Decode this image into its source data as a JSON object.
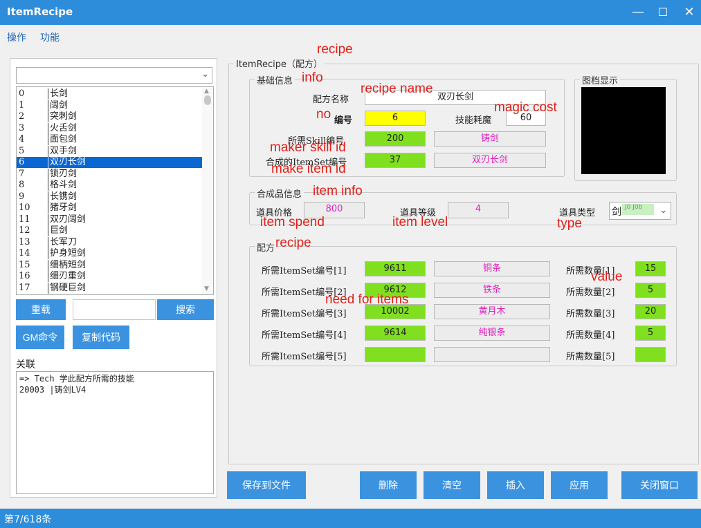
{
  "window": {
    "title": "ItemRecipe"
  },
  "menu": [
    "操作",
    "功能"
  ],
  "list": {
    "items": [
      {
        "id": "0",
        "name": "长剑"
      },
      {
        "id": "1",
        "name": "阔剑"
      },
      {
        "id": "2",
        "name": "突刺剑"
      },
      {
        "id": "3",
        "name": "火舌剑"
      },
      {
        "id": "4",
        "name": "面包剑"
      },
      {
        "id": "5",
        "name": "双手剑"
      },
      {
        "id": "6",
        "name": "双刃长剑"
      },
      {
        "id": "7",
        "name": "锁刃剑"
      },
      {
        "id": "8",
        "name": "格斗剑"
      },
      {
        "id": "9",
        "name": "长镌剑"
      },
      {
        "id": "10",
        "name": "猪牙剑"
      },
      {
        "id": "11",
        "name": "双刃阔剑"
      },
      {
        "id": "12",
        "name": "巨剑"
      },
      {
        "id": "13",
        "name": "长军刀"
      },
      {
        "id": "14",
        "name": "护身短剑"
      },
      {
        "id": "15",
        "name": "细柄短剑"
      },
      {
        "id": "16",
        "name": "细刃重剑"
      },
      {
        "id": "17",
        "name": "钢硬巨剑"
      }
    ],
    "selected_index": 6
  },
  "left_buttons": {
    "reload": "重载",
    "search": "搜索",
    "gm": "GM命令",
    "copy": "复制代码",
    "search_value": ""
  },
  "relation": {
    "label": "关联",
    "lines": [
      "=> Tech 学此配方所需的技能",
      "20003  |铸剑LV4"
    ]
  },
  "recipe_group": {
    "title": "ItemRecipe（配方）"
  },
  "basic": {
    "title": "基础信息",
    "name_label": "配方名称",
    "name_value": "双刃长剑",
    "no_label": "编号",
    "no_value": "6",
    "mp_label": "技能耗魔",
    "mp_value": "60",
    "skill_label": "所需Skill编号",
    "skill_value": "200",
    "skill_name": "铸剑",
    "itemset_label": "合成的ItemSet编号",
    "itemset_value": "37",
    "itemset_name": "双刃长剑"
  },
  "preview": {
    "title": "图档显示"
  },
  "product": {
    "title": "合成品信息",
    "price_label": "道具价格",
    "price_value": "800",
    "level_label": "道具等级",
    "level_value": "4",
    "type_label": "道具类型",
    "type_value": "剑",
    "type_ghost": "J0  J0b"
  },
  "recipe": {
    "title": "配方",
    "rows": [
      {
        "label": "所需ItemSet编号[1]",
        "id": "9611",
        "name": "铜条",
        "qty_label": "所需数量[1]",
        "qty": "15"
      },
      {
        "label": "所需ItemSet编号[2]",
        "id": "9612",
        "name": "铁条",
        "qty_label": "所需数量[2]",
        "qty": "5"
      },
      {
        "label": "所需ItemSet编号[3]",
        "id": "10002",
        "name": "黄月木",
        "qty_label": "所需数量[3]",
        "qty": "20"
      },
      {
        "label": "所需ItemSet编号[4]",
        "id": "9614",
        "name": "纯银条",
        "qty_label": "所需数量[4]",
        "qty": "5"
      },
      {
        "label": "所需ItemSet编号[5]",
        "id": "",
        "name": "",
        "qty_label": "所需数量[5]",
        "qty": ""
      }
    ]
  },
  "bottom_buttons": {
    "save": "保存到文件",
    "delete": "删除",
    "clear": "清空",
    "insert": "插入",
    "apply": "应用",
    "close": "关闭窗口"
  },
  "status": "第7/618条",
  "annotations": {
    "recipe_top": "recipe",
    "info": "info",
    "recipe_name": "recipe name",
    "no": "no",
    "magic_cost": "magic cost",
    "maker_skill_id": "maker skill id",
    "make_item_id": "make item id",
    "item_info": "item info",
    "item_spend": "item spend",
    "item_level": "item level",
    "type": "type",
    "recipe": "recipe",
    "value": "value",
    "need_for_items": "need for items"
  },
  "colors": {
    "titlebar": "#2d8ddb",
    "button": "#3b93e0",
    "green_field": "#80e020",
    "yellow_field": "#ffff00",
    "magenta_text": "#e020c0",
    "annotation": "#e0201a"
  }
}
